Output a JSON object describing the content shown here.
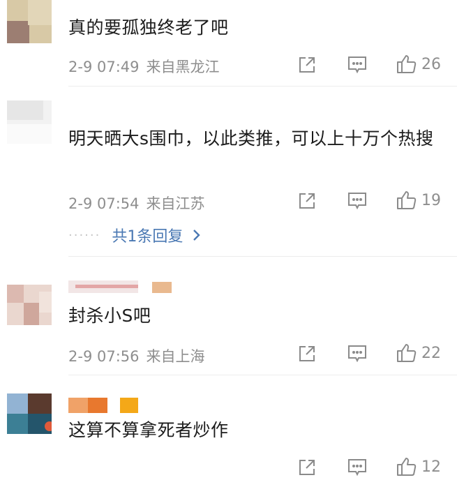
{
  "comments": [
    {
      "text": "真的要孤独终老了吧",
      "time": "2-9 07:49",
      "location": "来自黑龙江",
      "likes": "26"
    },
    {
      "text": "明天晒大s围巾，以此类推，可以上十万个热搜",
      "time": "2-9 07:54",
      "location": "来自江苏",
      "likes": "19",
      "replies_label": "共1条回复"
    },
    {
      "text": "封杀小S吧",
      "time": "2-9 07:56",
      "location": "来自上海",
      "likes": "22"
    },
    {
      "text": "这算不算拿死者炒作",
      "likes": "12"
    }
  ],
  "icons": {
    "share": "share-icon",
    "comment": "comment-icon",
    "like": "thumbs-up-icon",
    "reply_chevron": "chevron-right-icon"
  },
  "colors": {
    "meta_gray": "#8e8e8e",
    "link_blue": "#4a78b3",
    "divider": "#ececec"
  }
}
